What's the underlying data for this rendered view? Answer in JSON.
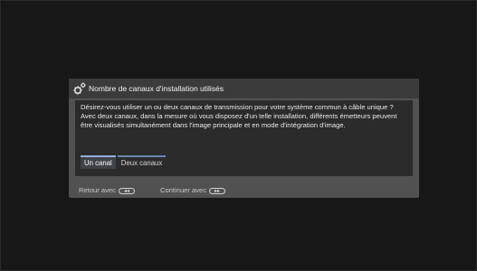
{
  "dialog": {
    "title": "Nombre de canaux d'installation utilisés",
    "message": "Désirez-vous utiliser un ou deux canaux de transmission pour votre système commun à câble unique ? Avec deux canaux, dans la mesure où vous disposez d'un telle installation, différents émetteurs peuvent être visualisés simultanément dans l'image principale et en mode d'intégration d'image.",
    "options": [
      {
        "label": "Un canal",
        "selected": true
      },
      {
        "label": "Deux canaux",
        "selected": false
      }
    ]
  },
  "footer": {
    "back_label": "Retour avec",
    "back_icon": "rewind-key-icon",
    "continue_label": "Continuer avec",
    "continue_icon": "fast-forward-key-icon"
  },
  "colors": {
    "screen_background": "#171717",
    "dialog_background": "#515151",
    "body_background": "#2b2b2b",
    "selection_accent": "#8fb0e0"
  }
}
